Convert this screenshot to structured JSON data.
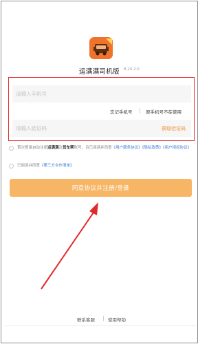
{
  "app": {
    "name": "运满满司机版",
    "version": "8.24.2.0",
    "logo_icon": "truck-icon",
    "accent_color": "#f0732c"
  },
  "login": {
    "phone_placeholder": "请输入手机号",
    "code_placeholder": "请输入验证码",
    "forgot_phone": "忘记手机号",
    "phone_not_in_use": "原手机号不在使用",
    "get_code": "获取验证码"
  },
  "agreement": {
    "line1_prefix": "首次登录自动注册",
    "brand1": "运满满",
    "line1_mid1": "及",
    "brand2": "货车帮",
    "line1_mid2": "账号，且已阅读并同意",
    "link_user_service": "《用户服务协议》",
    "link_privacy": "《隐私政策》",
    "link_user_auth": "《用户授权协议》",
    "line2_prefix": "已阅读并同意",
    "link_third_party": "《第三方合作清单》"
  },
  "submit_button": "同意协议并注册/登录",
  "footer": {
    "contact": "联系客服",
    "help": "使用帮助"
  },
  "colors": {
    "highlight_box": "#e12a2a",
    "button": "#f7b566",
    "link": "#3b7bd8",
    "get_code": "#f0913b"
  }
}
